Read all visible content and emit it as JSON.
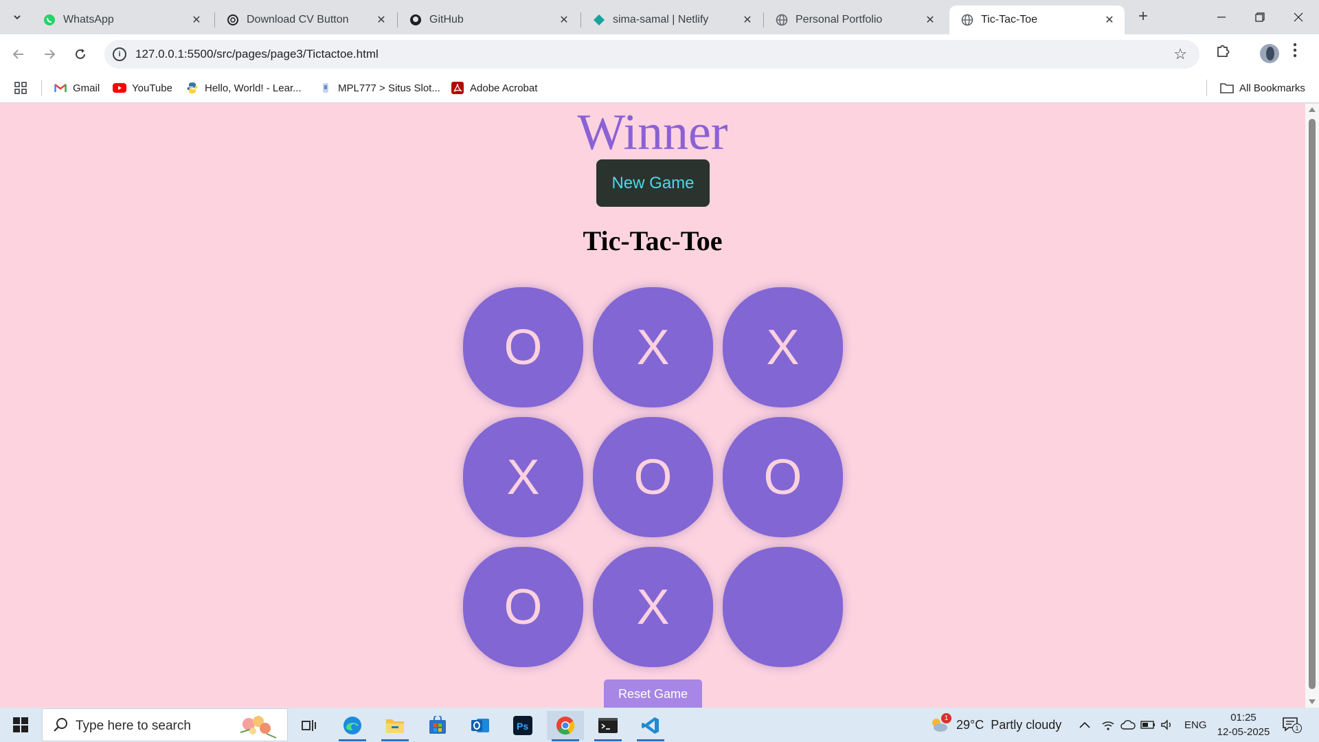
{
  "browser": {
    "tabs": [
      {
        "title": "WhatsApp",
        "icon": "whatsapp-icon",
        "active": false
      },
      {
        "title": "Download CV Button",
        "icon": "openai-icon",
        "active": false
      },
      {
        "title": "GitHub",
        "icon": "github-icon",
        "active": false
      },
      {
        "title": "sima-samal | Netlify",
        "icon": "netlify-icon",
        "active": false
      },
      {
        "title": "Personal Portfolio",
        "icon": "globe-icon",
        "active": false
      },
      {
        "title": "Tic-Tac-Toe",
        "icon": "globe-icon",
        "active": true
      }
    ],
    "url": "127.0.0.1:5500/src/pages/page3/Tictactoe.html",
    "bookmarks": [
      {
        "label": "Gmail",
        "icon": "gmail-icon"
      },
      {
        "label": "YouTube",
        "icon": "youtube-icon"
      },
      {
        "label": "Hello, World! - Lear...",
        "icon": "python-icon"
      },
      {
        "label": "MPL777 > Situs Slot...",
        "icon": "site-icon"
      },
      {
        "label": "Adobe Acrobat",
        "icon": "acrobat-icon"
      }
    ],
    "all_bookmarks_label": "All Bookmarks"
  },
  "page": {
    "winner_text": "Winner",
    "new_game_label": "New Game",
    "title": "Tic-Tac-Toe",
    "board": [
      "O",
      "X",
      "X",
      "X",
      "O",
      "O",
      "O",
      "X",
      ""
    ],
    "reset_label": "Reset Game",
    "colors": {
      "background": "#fdd3e0",
      "cell": "#8266d4",
      "cell_text": "#fbd1e0",
      "winner": "#8b61d6",
      "new_game_bg": "#2a332e",
      "new_game_text": "#4ad9e8",
      "reset_bg": "#a786e6"
    }
  },
  "taskbar": {
    "search_placeholder": "Type here to search",
    "apps": [
      "task-view-icon",
      "edge-icon",
      "file-explorer-icon",
      "store-icon",
      "outlook-icon",
      "photoshop-icon",
      "chrome-icon",
      "terminal-icon",
      "vscode-icon"
    ],
    "weather_temp": "29°C",
    "weather_desc": "Partly cloudy",
    "weather_badge": "1",
    "language": "ENG",
    "time": "01:25",
    "date": "12-05-2025",
    "notification_count": "1"
  }
}
